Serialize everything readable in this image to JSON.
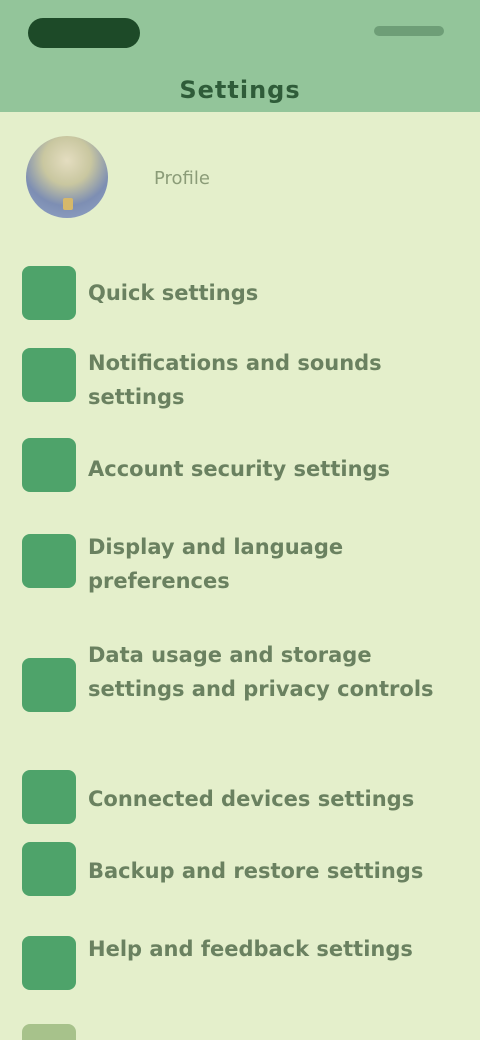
{
  "header": {
    "title": "Settings"
  },
  "profile": {
    "name": "Profile",
    "avatar_icon": "user-avatar-icon"
  },
  "menu": {
    "items": [
      {
        "label": "Quick settings",
        "icon": "green-square-icon"
      },
      {
        "label": "Notifications and sounds settings",
        "icon": "green-square-icon"
      },
      {
        "label": "Account security settings",
        "icon": "green-square-icon"
      },
      {
        "label": "Display and language preferences",
        "icon": "green-square-icon"
      },
      {
        "label": "Data usage and storage settings and privacy controls",
        "icon": "green-square-icon"
      },
      {
        "label": "Connected devices settings",
        "icon": "green-square-icon"
      },
      {
        "label": "Backup and restore settings",
        "icon": "green-square-icon"
      },
      {
        "label": "Help and feedback settings",
        "icon": "green-square-icon"
      }
    ]
  },
  "colors": {
    "header_bg": "#93c59a",
    "page_bg": "#e4efcb",
    "icon_green": "#4ea36a",
    "text": "#6a8160"
  }
}
